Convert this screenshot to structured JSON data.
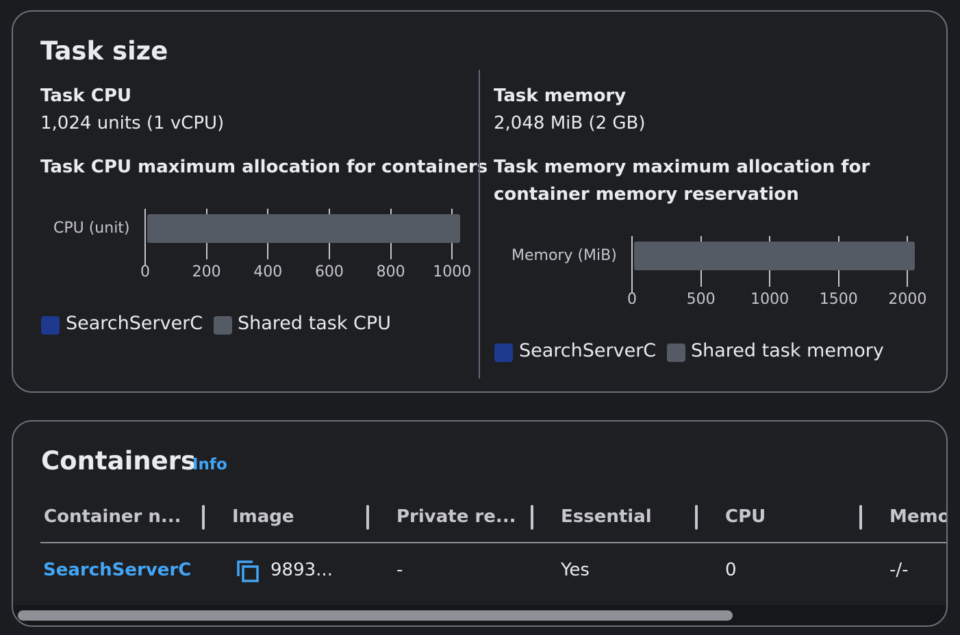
{
  "task_size": {
    "title": "Task size",
    "cpu": {
      "label": "Task CPU",
      "value": "1,024 units (1 vCPU)",
      "allocation_title": "Task CPU maximum allocation for containers"
    },
    "memory": {
      "label": "Task memory",
      "value": "2,048 MiB (2 GB)",
      "allocation_title_line1": "Task memory maximum allocation for",
      "allocation_title_line2": "container memory reservation"
    }
  },
  "chart_data": [
    {
      "type": "bar",
      "orientation": "horizontal",
      "stacked": true,
      "ylabel": "CPU (unit)",
      "xlim": [
        0,
        1024
      ],
      "xticks": [
        "0",
        "200",
        "400",
        "600",
        "800",
        "1000"
      ],
      "series": [
        {
          "name": "SearchServerC",
          "values": [
            0
          ],
          "color": "#1d3a8f"
        },
        {
          "name": "Shared task CPU",
          "values": [
            1024
          ],
          "color": "#545b64"
        }
      ]
    },
    {
      "type": "bar",
      "orientation": "horizontal",
      "stacked": true,
      "ylabel": "Memory (MiB)",
      "xlim": [
        0,
        2048
      ],
      "xticks": [
        "0",
        "500",
        "1000",
        "1500",
        "2000"
      ],
      "series": [
        {
          "name": "SearchServerC",
          "values": [
            0
          ],
          "color": "#1d3a8f"
        },
        {
          "name": "Shared task memory",
          "values": [
            2048
          ],
          "color": "#545b64"
        }
      ]
    }
  ],
  "containers": {
    "title": "Containers",
    "info_link": "Info",
    "columns": [
      "Container n...",
      "Image",
      "Private re...",
      "Essential",
      "CPU",
      "Memo"
    ],
    "rows": [
      {
        "name": "SearchServerC",
        "image": "9893...",
        "private_registry": "-",
        "essential": "Yes",
        "cpu": "0",
        "memory": "-/-"
      }
    ],
    "icons": {
      "copy": "copy-icon"
    }
  },
  "colors": {
    "accent_link": "#42a5f5",
    "container_series": "#1d3a8f",
    "shared_series": "#545b64",
    "background": "#1b1c20"
  }
}
